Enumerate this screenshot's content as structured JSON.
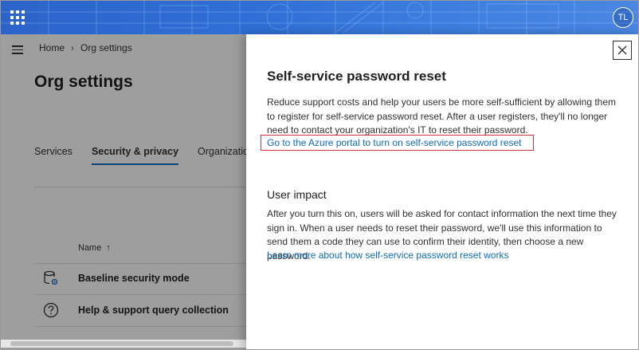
{
  "header": {
    "avatar_initials": "TL",
    "accent_color": "#2f6fd6"
  },
  "breadcrumb": {
    "home": "Home",
    "current": "Org settings"
  },
  "page": {
    "title": "Org settings"
  },
  "tabs": [
    {
      "label": "Services",
      "active": false
    },
    {
      "label": "Security & privacy",
      "active": true
    },
    {
      "label": "Organization p",
      "active": false
    }
  ],
  "table": {
    "column_name": "Name",
    "sort_indicator": "↑",
    "rows": [
      {
        "icon": "database-gear-icon",
        "label": "Baseline security mode"
      },
      {
        "icon": "question-circle-icon",
        "label": "Help & support query collection"
      }
    ]
  },
  "panel": {
    "title": "Self-service password reset",
    "description": "Reduce support costs and help your users be more self-sufficient by allowing them to register for self-service password reset. After a user registers, they'll no longer need to contact your organization's IT to reset their password.",
    "azure_link": "Go to the Azure portal to turn on self-service password reset",
    "impact_title": "User impact",
    "impact_description": "After you turn this on, users will be asked for contact information the next time they sign in. When a user needs to reset their password, we'll use this information to send them a code they can use to confirm their identity, then choose a new password.",
    "learn_more_link": "Learn more about how self-service password reset works",
    "highlight_color": "#d13438",
    "link_color": "#0f6cbd"
  }
}
